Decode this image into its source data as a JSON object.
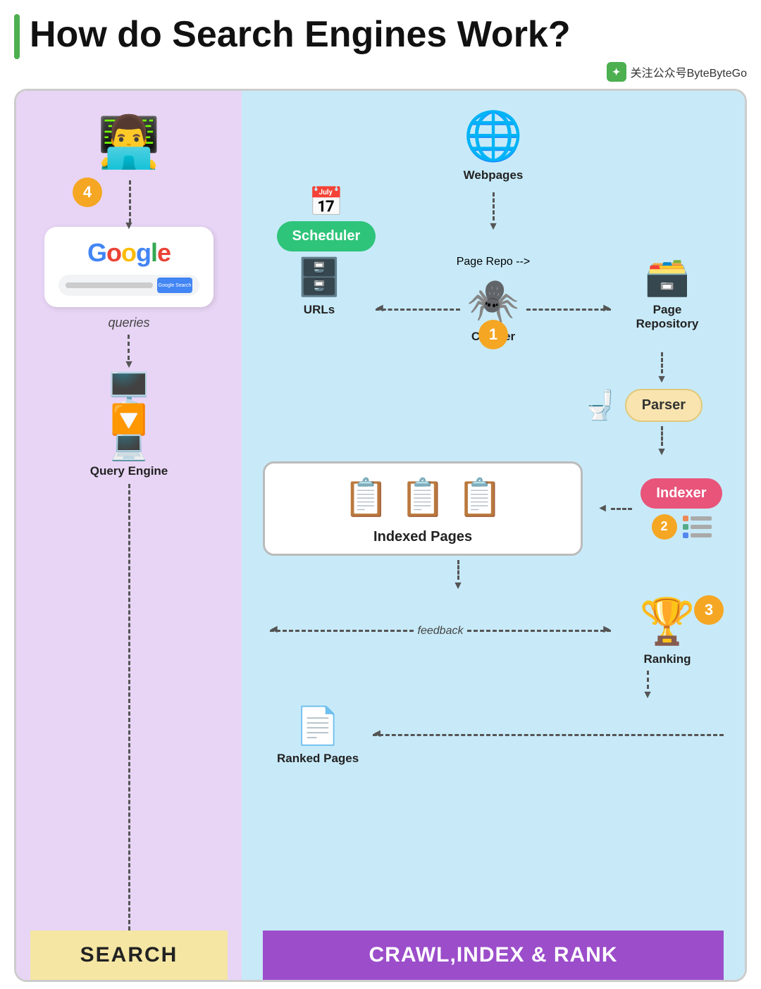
{
  "title": "How do Search Engines Work?",
  "logo_text": "关注公众号ByteByteGo",
  "left_panel": {
    "footer": "SEARCH",
    "step4_badge": "4",
    "google_label": "Google",
    "queries_label": "queries",
    "query_engine_label": "Query Engine"
  },
  "right_panel": {
    "footer": "CRAWL,INDEX & RANK",
    "webpages_label": "Webpages",
    "scheduler_label": "Scheduler",
    "urls_label": "URLs",
    "crawler_label": "Crawler",
    "step1_badge": "1",
    "page_repository_label": "Page\nRepository",
    "parser_label": "Parser",
    "indexer_label": "Indexer",
    "step2_badge": "2",
    "indexed_pages_label": "Indexed Pages",
    "ranking_label": "Ranking",
    "step3_badge": "3",
    "ranked_pages_label": "Ranked\nPages",
    "feedback_label": "feedback"
  }
}
